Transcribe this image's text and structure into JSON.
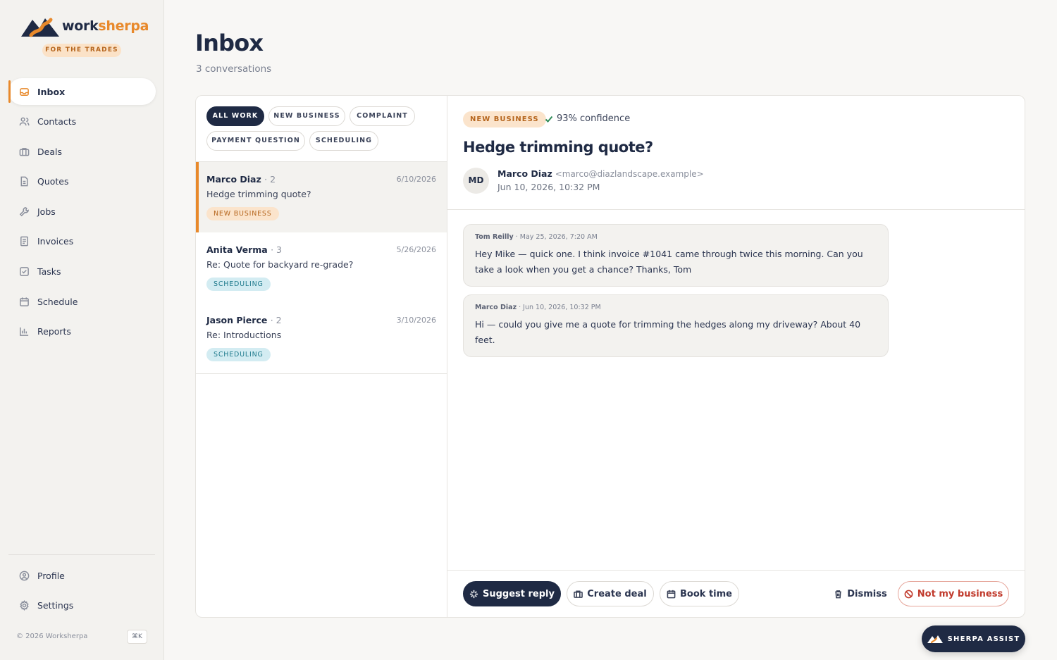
{
  "brand": {
    "name_part1": "work",
    "name_part2": "sherpa",
    "tagline": "FOR THE TRADES",
    "accent": "#e8892b",
    "navy": "#1f2a44"
  },
  "sidebar": {
    "items": [
      {
        "label": "Inbox",
        "icon": "inbox-icon",
        "active": true
      },
      {
        "label": "Contacts",
        "icon": "users-icon"
      },
      {
        "label": "Deals",
        "icon": "briefcase-icon"
      },
      {
        "label": "Quotes",
        "icon": "document-icon"
      },
      {
        "label": "Jobs",
        "icon": "wrench-icon"
      },
      {
        "label": "Invoices",
        "icon": "invoice-icon"
      },
      {
        "label": "Tasks",
        "icon": "checkbox-icon"
      },
      {
        "label": "Schedule",
        "icon": "calendar-icon"
      },
      {
        "label": "Reports",
        "icon": "bar-chart-icon"
      }
    ],
    "bottom_items": [
      {
        "label": "Profile",
        "icon": "profile-icon"
      },
      {
        "label": "Settings",
        "icon": "gear-icon"
      }
    ],
    "copyright": "© 2026 Worksherpa",
    "shortcut": "⌘K"
  },
  "header": {
    "title": "Inbox",
    "subtitle": "3 conversations"
  },
  "filters": [
    "ALL WORK",
    "NEW BUSINESS",
    "COMPLAINT",
    "PAYMENT QUESTION",
    "SCHEDULING"
  ],
  "active_filter": "ALL WORK",
  "conversations": [
    {
      "name": "Marco Diaz",
      "count": "· 2",
      "date": "6/10/2026",
      "subject": "Hedge trimming quote?",
      "tag": "NEW BUSINESS",
      "selected": true
    },
    {
      "name": "Anita Verma",
      "count": "· 3",
      "date": "5/26/2026",
      "subject": "Re: Quote for backyard re-grade?",
      "tag": "SCHEDULING"
    },
    {
      "name": "Jason Pierce",
      "count": "· 2",
      "date": "3/10/2026",
      "subject": "Re: Introductions",
      "tag": "SCHEDULING"
    }
  ],
  "detail": {
    "tag": "NEW BUSINESS",
    "confidence": "93% confidence",
    "title": "Hedge trimming quote?",
    "avatar_initials": "MD",
    "sender_name": "Marco Diaz",
    "sender_email": "<marco@diazlandscape.example>",
    "sent_at": "Jun 10, 2026, 10:32 PM",
    "messages": [
      {
        "from": "Tom Reilly",
        "meta": "· May 25, 2026, 7:20 AM",
        "body": "Hey Mike — quick one. I think invoice #1041 came through twice this morning. Can you take a look when you get a chance? Thanks, Tom"
      },
      {
        "from": "Marco Diaz",
        "meta": "· Jun 10, 2026, 10:32 PM",
        "body": "Hi — could you give me a quote for trimming the hedges along my driveway? About 40 feet."
      }
    ]
  },
  "actions": {
    "suggest_reply": "Suggest reply",
    "create_deal": "Create deal",
    "book_time": "Book time",
    "dismiss": "Dismiss",
    "not_my_business": "Not my business"
  },
  "assist": {
    "label": "SHERPA ASSIST"
  }
}
